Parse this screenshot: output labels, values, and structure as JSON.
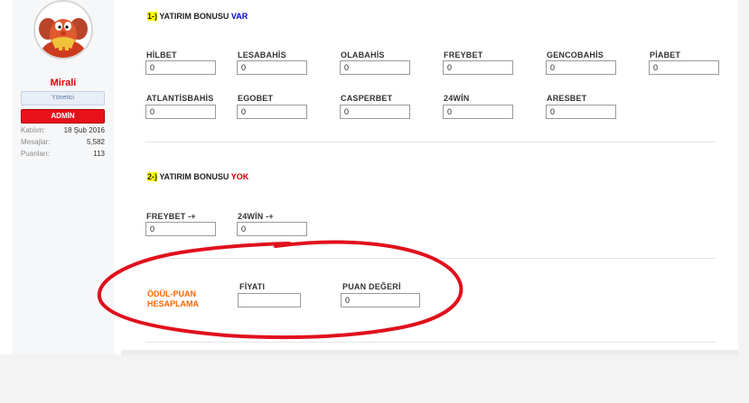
{
  "user": {
    "name": "Mirali",
    "role": "Yönetici",
    "badge": "ADMİN",
    "stats": [
      {
        "label": "Katılım:",
        "value": "18 Şub 2016"
      },
      {
        "label": "Mesajlar:",
        "value": "5,582"
      },
      {
        "label": "Puanları:",
        "value": "113"
      }
    ]
  },
  "section1": {
    "number": "1-)",
    "title": "YATIRIM BONUSU",
    "status": "VAR"
  },
  "section1_fields": [
    {
      "label": "HİLBET",
      "value": "0"
    },
    {
      "label": "LESABAHİS",
      "value": "0"
    },
    {
      "label": "OLABAHİS",
      "value": "0"
    },
    {
      "label": "FREYBET",
      "value": "0"
    },
    {
      "label": "GENCOBAHİS",
      "value": "0"
    },
    {
      "label": "PİABET",
      "value": "0"
    },
    {
      "label": "ATLANTİSBAHİS",
      "value": "0"
    },
    {
      "label": "EGOBET",
      "value": "0"
    },
    {
      "label": "CASPERBET",
      "value": "0"
    },
    {
      "label": "24WİN",
      "value": "0"
    },
    {
      "label": "ARESBET",
      "value": "0"
    }
  ],
  "section2": {
    "number": "2-)",
    "title": "YATIRIM BONUSU",
    "status": "YOK"
  },
  "section2_fields": [
    {
      "label": "FREYBET -+",
      "value": "0"
    },
    {
      "label": "24WİN -+",
      "value": "0"
    }
  ],
  "reward": {
    "title_line1": "ÖDÜL-PUAN",
    "title_line2": "HESAPLAMA",
    "price_label": "FİYATI",
    "price_value": "",
    "points_label": "PUAN DEĞERİ",
    "points_value": "0"
  },
  "colors": {
    "username": "#dd0000",
    "admin_badge": "#e8111b",
    "var": "#0000cc",
    "yok": "#cc0000",
    "reward": "#ff6600",
    "annotation": "#e0101c"
  }
}
